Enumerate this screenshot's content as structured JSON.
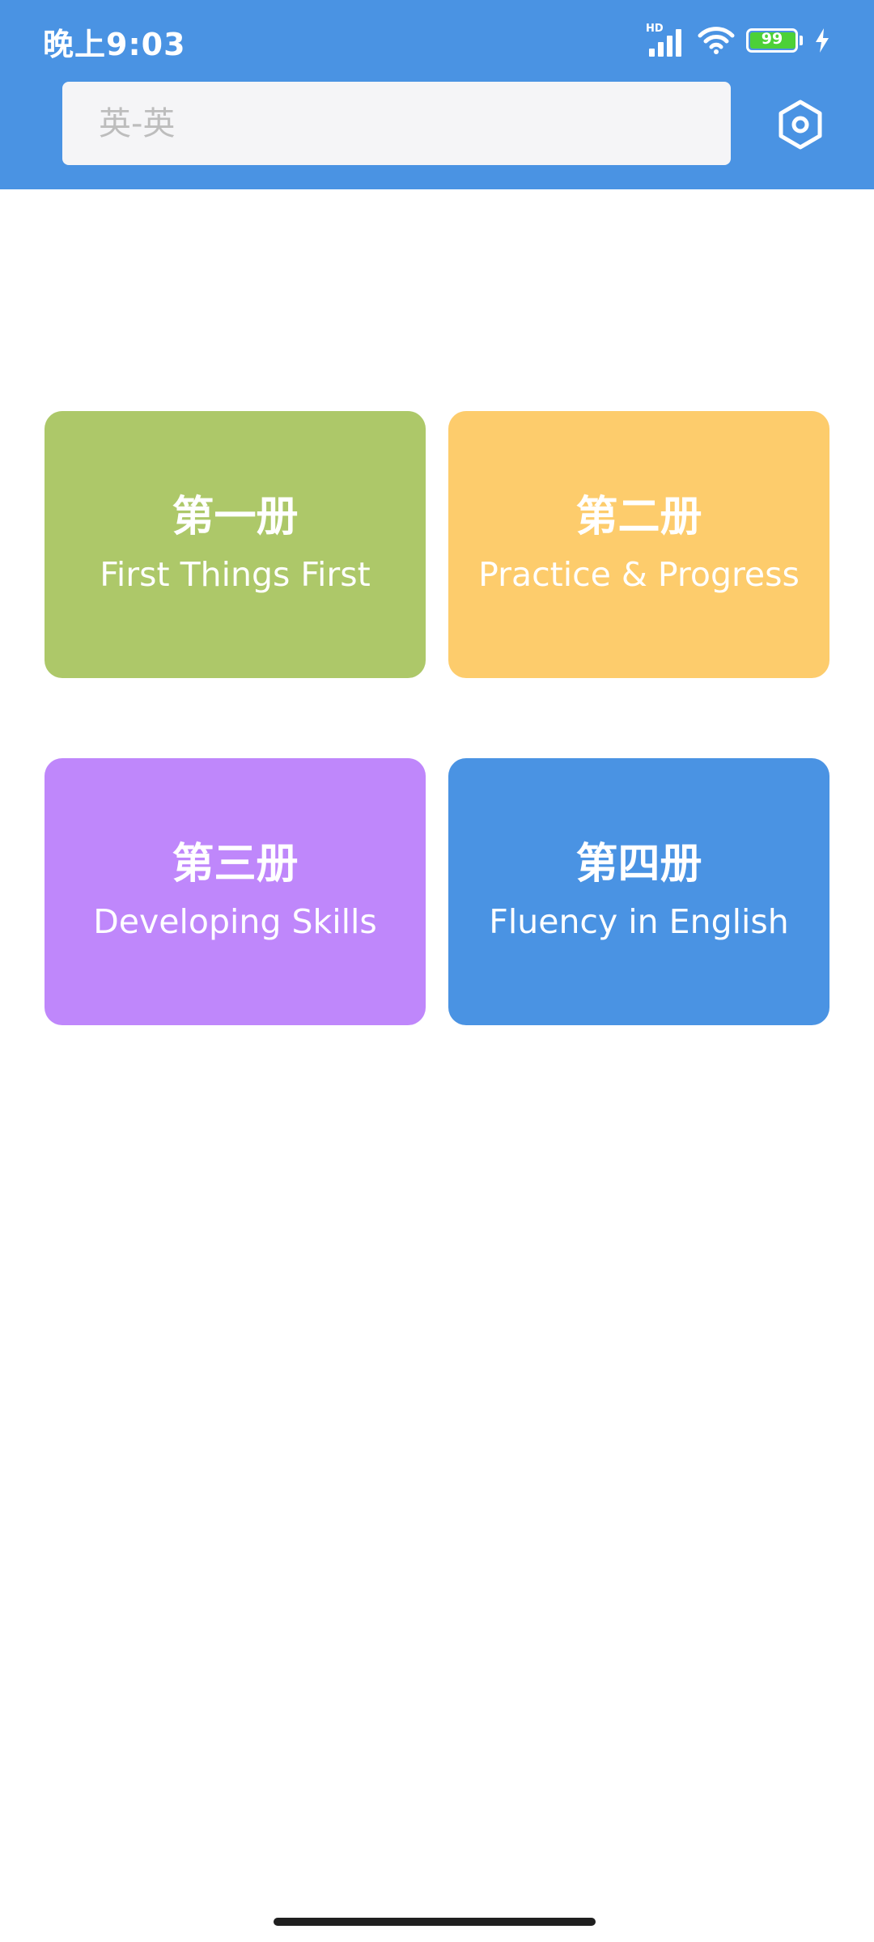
{
  "status_bar": {
    "time": "晚上9:03",
    "network_label": "HD",
    "battery_level": "99"
  },
  "search": {
    "placeholder": "英-英",
    "value": ""
  },
  "books": [
    {
      "title_cn": "第一册",
      "title_en": "First Things First",
      "color": "#adc869"
    },
    {
      "title_cn": "第二册",
      "title_en": "Practice & Progress",
      "color": "#fdcc6c"
    },
    {
      "title_cn": "第三册",
      "title_en": "Developing Skills",
      "color": "#bf87fb"
    },
    {
      "title_cn": "第四册",
      "title_en": "Fluency in English",
      "color": "#4a93e3"
    }
  ],
  "colors": {
    "appbar": "#4a93e3",
    "background": "#ffffff"
  }
}
